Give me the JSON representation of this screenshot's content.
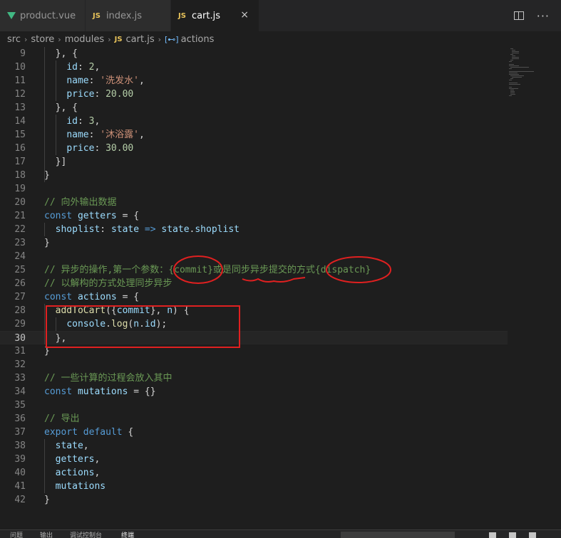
{
  "tabs": [
    {
      "label": "product.vue",
      "icon": "vue-icon"
    },
    {
      "label": "index.js",
      "icon": "js-icon",
      "badge": "JS"
    },
    {
      "label": "cart.js",
      "icon": "js-icon",
      "badge": "JS",
      "active": true
    }
  ],
  "tab_close_glyph": "×",
  "breadcrumb": {
    "items": [
      "src",
      "store",
      "modules"
    ],
    "file": "cart.js",
    "file_badge": "JS",
    "symbol": "actions",
    "symbol_glyph": "[⊷]"
  },
  "code_lines": [
    {
      "n": "9",
      "text": "  }, {"
    },
    {
      "n": "10",
      "text": "    id: 2,"
    },
    {
      "n": "11",
      "text": "    name: '洗发水',"
    },
    {
      "n": "12",
      "text": "    price: 20.00"
    },
    {
      "n": "13",
      "text": "  }, {"
    },
    {
      "n": "14",
      "text": "    id: 3,"
    },
    {
      "n": "15",
      "text": "    name: '沐浴露',"
    },
    {
      "n": "16",
      "text": "    price: 30.00"
    },
    {
      "n": "17",
      "text": "  }]"
    },
    {
      "n": "18",
      "text": "}"
    },
    {
      "n": "19",
      "text": ""
    },
    {
      "n": "20",
      "text": "// 向外输出数据"
    },
    {
      "n": "21",
      "text": "const getters = {"
    },
    {
      "n": "22",
      "text": "  shoplist: state => state.shoplist"
    },
    {
      "n": "23",
      "text": "}"
    },
    {
      "n": "24",
      "text": ""
    },
    {
      "n": "25",
      "text": "// 异步的操作,第一个参数：{commit}或是同步异步提交的方式{dispatch}"
    },
    {
      "n": "26",
      "text": "// 以解构的方式处理同步异步"
    },
    {
      "n": "27",
      "text": "const actions = {"
    },
    {
      "n": "28",
      "text": "  addToCart({commit}, n) {"
    },
    {
      "n": "29",
      "text": "    console.log(n.id);"
    },
    {
      "n": "30",
      "text": "  },"
    },
    {
      "n": "31",
      "text": "}"
    },
    {
      "n": "32",
      "text": ""
    },
    {
      "n": "33",
      "text": "// 一些计算的过程会放入其中"
    },
    {
      "n": "34",
      "text": "const mutations = {}"
    },
    {
      "n": "35",
      "text": ""
    },
    {
      "n": "36",
      "text": "// 导出"
    },
    {
      "n": "37",
      "text": "export default {"
    },
    {
      "n": "38",
      "text": "  state,"
    },
    {
      "n": "39",
      "text": "  getters,"
    },
    {
      "n": "40",
      "text": "  actions,"
    },
    {
      "n": "41",
      "text": "  mutations"
    },
    {
      "n": "42",
      "text": "}"
    }
  ],
  "current_line": "30",
  "colors": {
    "keyword": "#569cd6",
    "string": "#ce9178",
    "number": "#b5cea8",
    "comment": "#6a9955",
    "variable": "#9cdcfe",
    "function": "#dcdcaa",
    "annotation": "#e02020"
  },
  "bottom_panel_tabs": [
    "问题",
    "输出",
    "调试控制台",
    "终端"
  ]
}
